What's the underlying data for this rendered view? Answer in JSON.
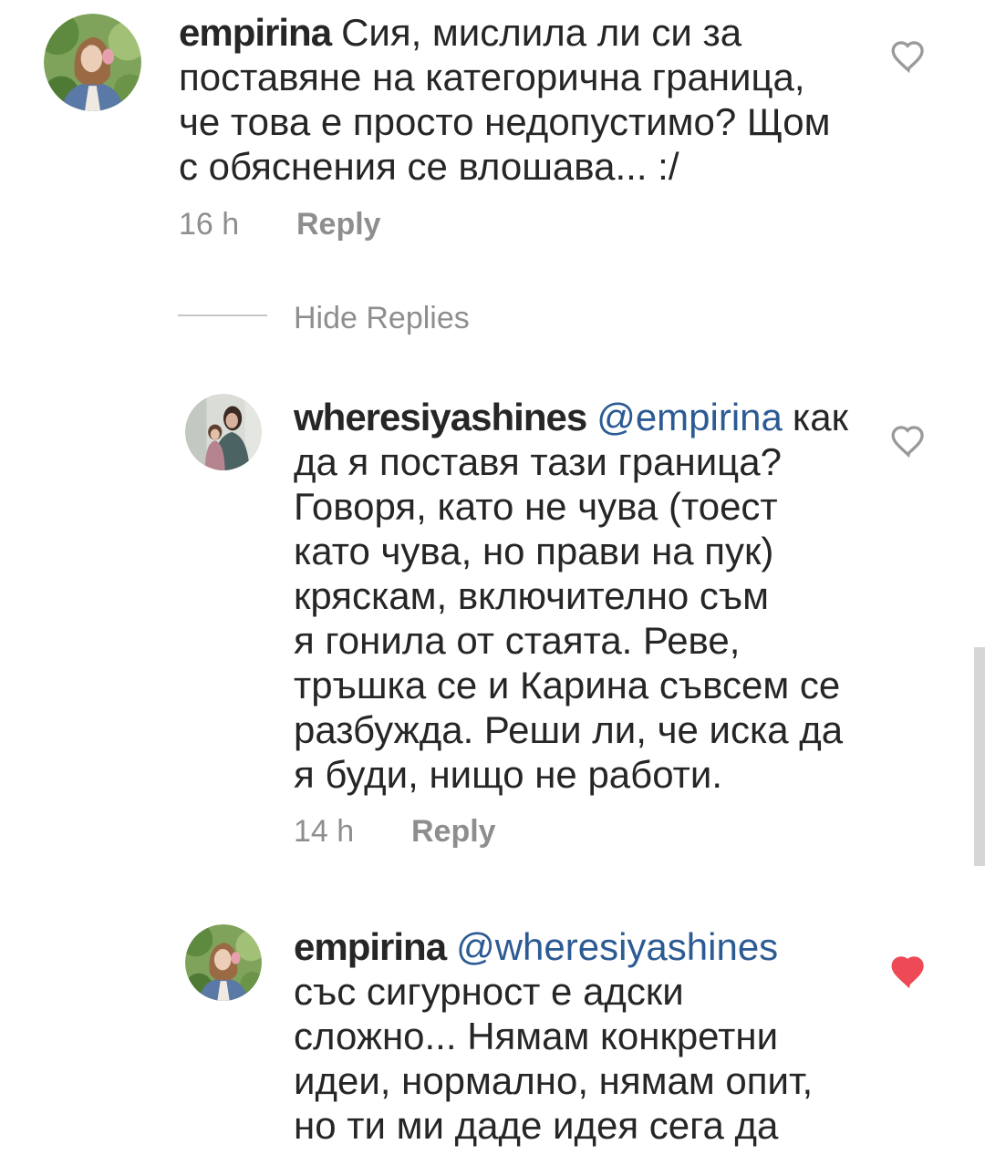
{
  "colors": {
    "background": "#ffffff",
    "text": "#262626",
    "secondary_text": "#8e8e8e",
    "mention": "#2c5b94",
    "like_active": "#ed4956",
    "icon": "#9a9a9a",
    "divider": "#c7c7c7",
    "scrollbar": "#d6d6d6"
  },
  "icons": {
    "like": "heart-outline-icon",
    "liked": "heart-filled-icon"
  },
  "thread": {
    "comment": {
      "username": "empirina",
      "inline_text": "Сия, мислила ли си за",
      "lines": [
        "поставяне на категорична граница,",
        "че това е просто недопустимо? Щом",
        "с обяснения се влошава... :/"
      ],
      "time": "16 h",
      "reply_label": "Reply",
      "liked": false
    },
    "hide_replies_label": "Hide Replies",
    "replies": [
      {
        "username": "wheresiyashines",
        "mention": "@empirina",
        "inline_text": "как",
        "lines": [
          "да я поставя тази граница?",
          "Говоря, като не чува (тоест",
          "като чува, но прави на пук)",
          "кряскам, включително съм",
          "я гонила от стаята. Реве,",
          "тръшка се и Карина съвсем се",
          "разбужда. Реши ли, че иска да",
          "я буди, нищо не работи."
        ],
        "time": "14 h",
        "reply_label": "Reply",
        "liked": false
      },
      {
        "username": "empirina",
        "mention": "@wheresiyashines",
        "lines": [
          "със сигурност е адски",
          "сложно... Нямам конкретни",
          "идеи, нормално, нямам опит,",
          "но ти ми даде идея сега да"
        ],
        "liked": true
      }
    ]
  }
}
